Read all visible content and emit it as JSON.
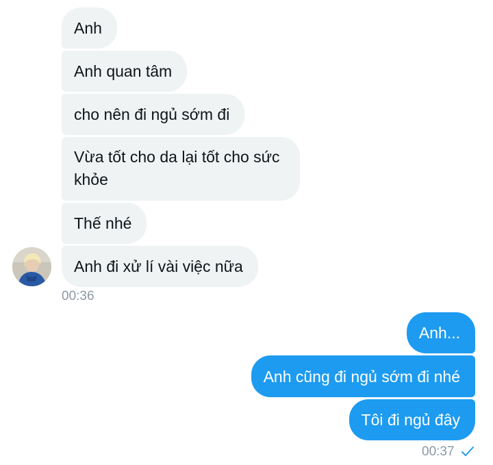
{
  "incoming": {
    "messages": [
      "Anh",
      "Anh quan tâm",
      "cho nên đi ngủ sớm đi",
      "Vừa tốt cho da lại tốt cho sức khỏe",
      "Thế nhé",
      "Anh đi xử lí vài việc nữa"
    ],
    "timestamp": "00:36"
  },
  "outgoing": {
    "messages": [
      "Anh...",
      "Anh cũng đi ngủ sớm đi nhé",
      "Tôi đi ngủ đây"
    ],
    "timestamp": "00:37",
    "read_icon": "checkmark-icon"
  },
  "colors": {
    "incoming_bubble": "#eff3f4",
    "outgoing_bubble": "#1d9bf0",
    "timestamp": "#8b98a5"
  }
}
